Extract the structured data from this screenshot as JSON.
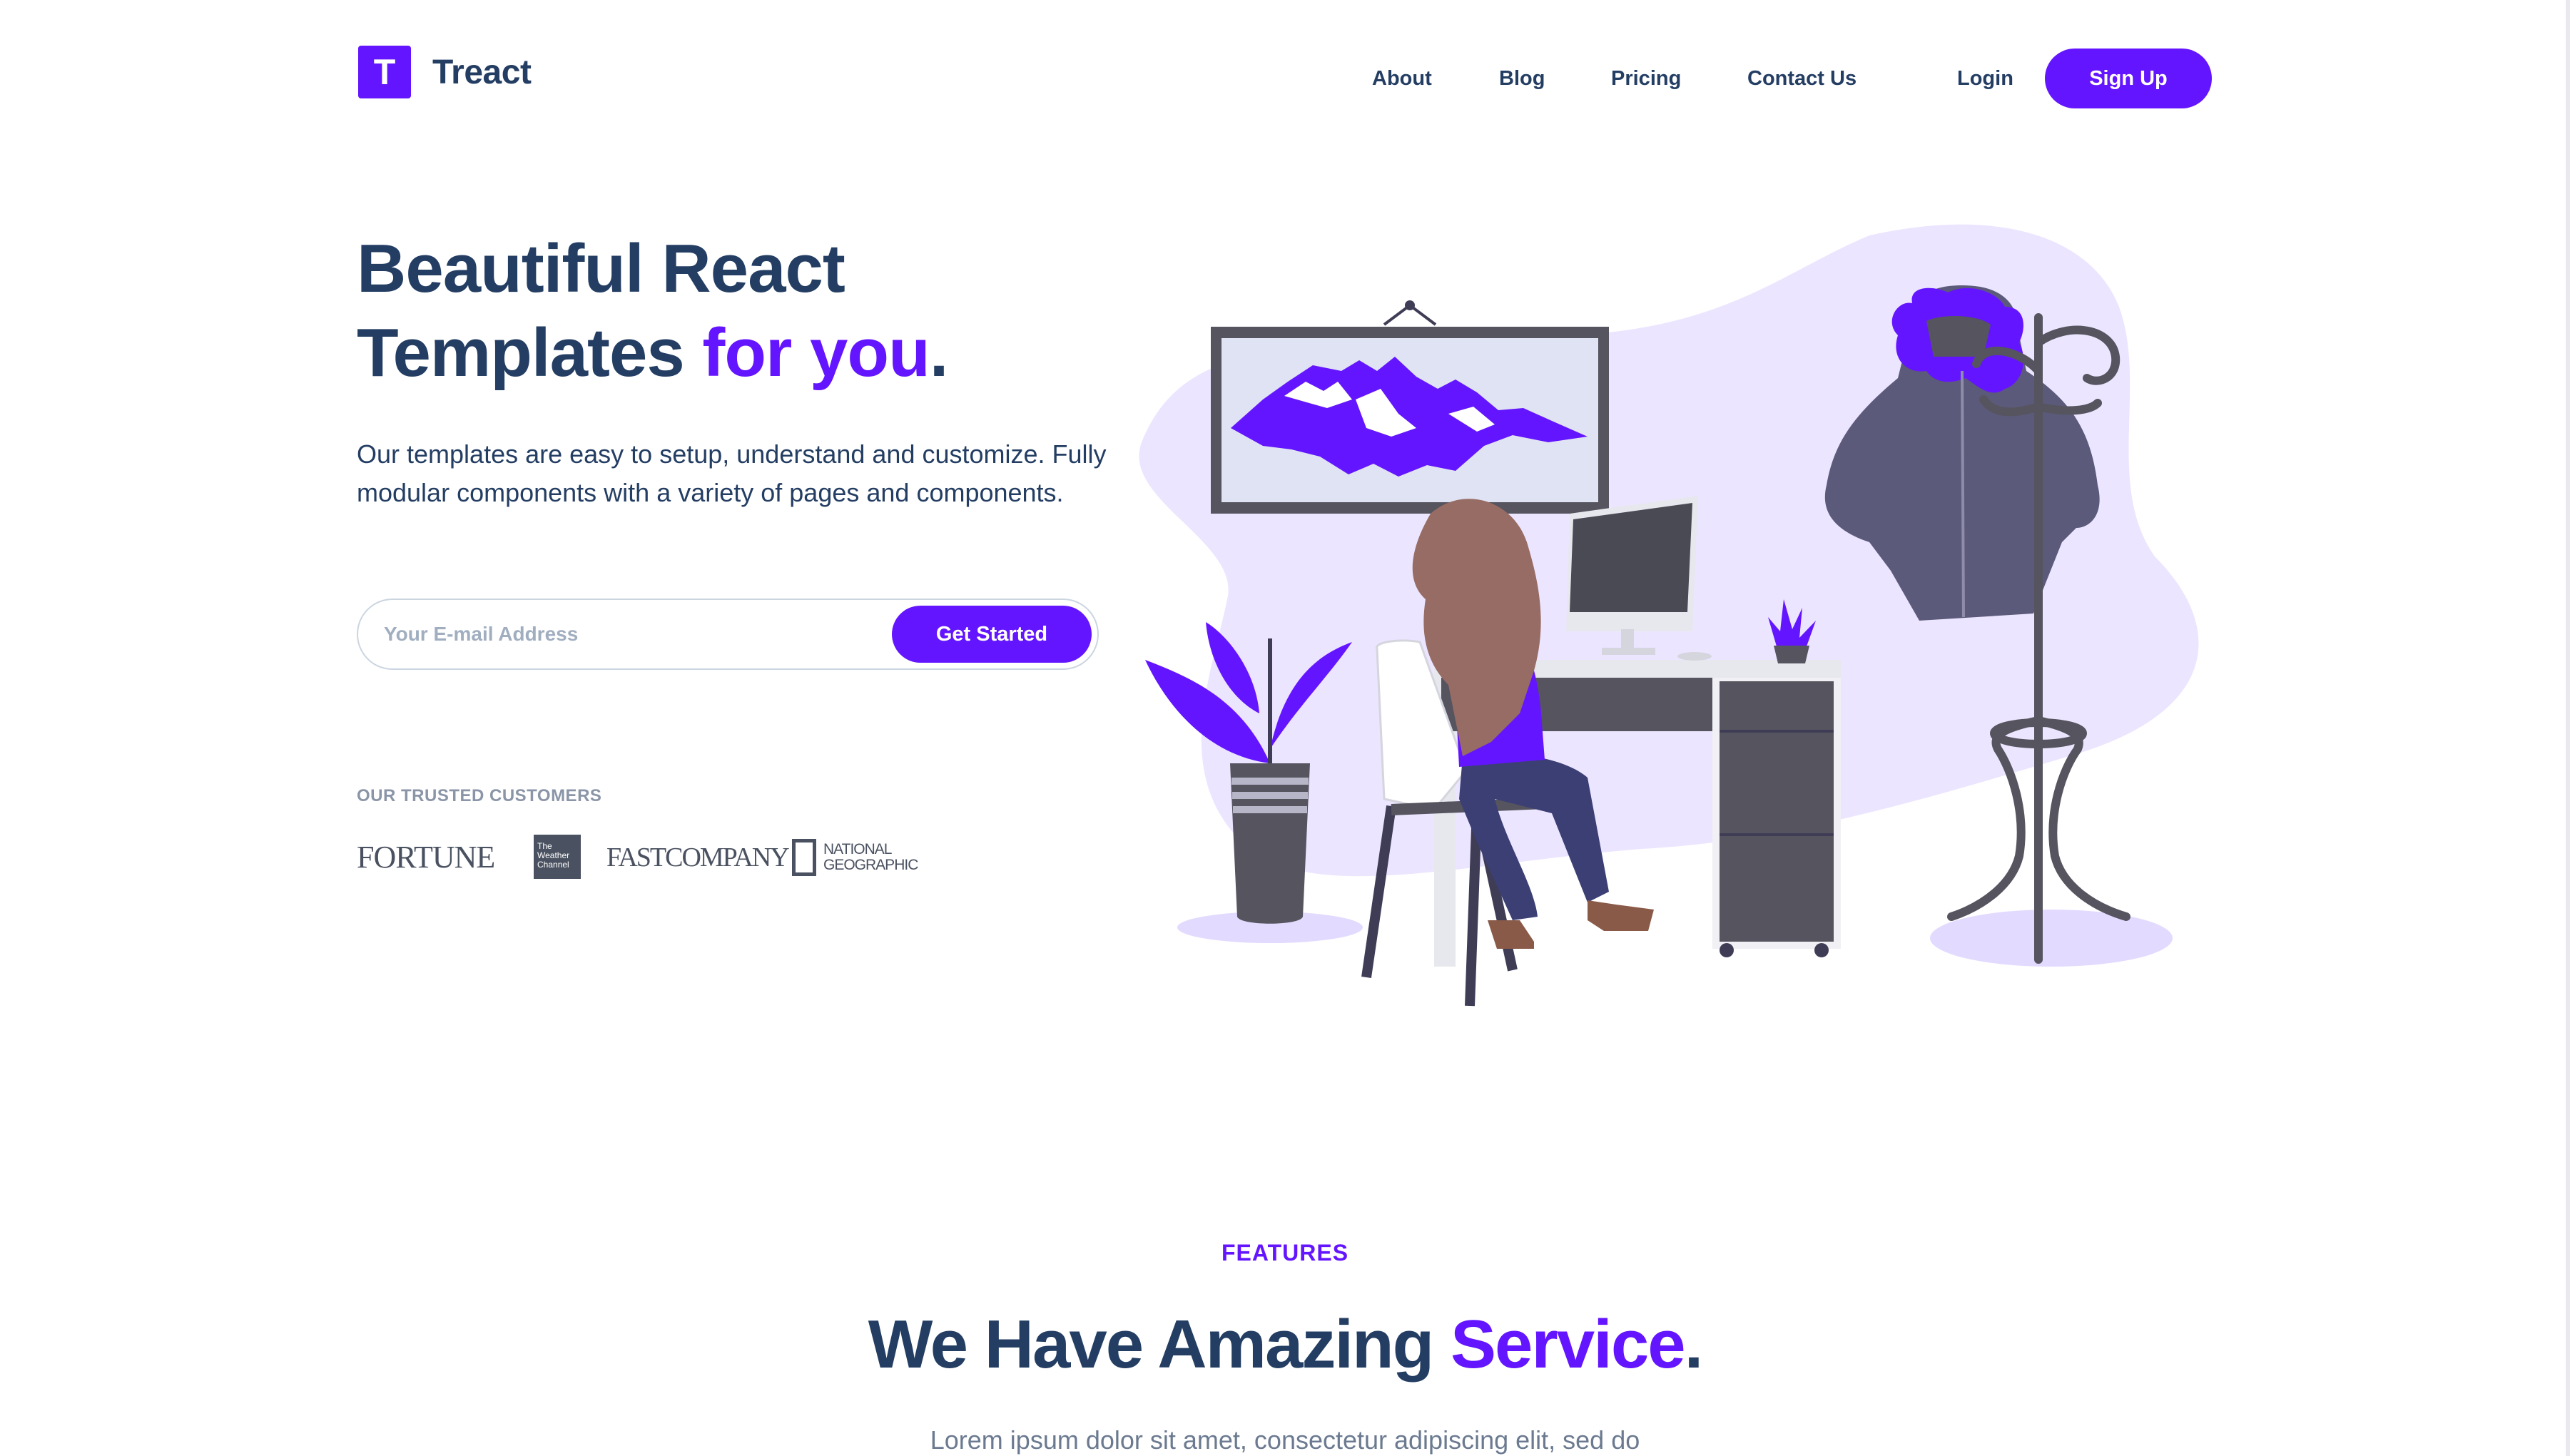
{
  "brand": {
    "logo_letter": "T",
    "name": "Treact",
    "accent_color": "#6415FF",
    "text_color": "#243E63"
  },
  "nav": {
    "links": [
      "About",
      "Blog",
      "Pricing",
      "Contact Us"
    ],
    "login": "Login",
    "signup": "Sign Up"
  },
  "hero": {
    "title_line1": "Beautiful React",
    "title_line2_main": "Templates ",
    "title_line2_accent": "for you",
    "title_period": ".",
    "description": "Our templates are easy to setup, understand and customize. Fully modular components with a variety of pages and components.",
    "email_placeholder": "Your E-mail Address",
    "cta_label": "Get Started"
  },
  "customers": {
    "label": "OUR TRUSTED CUSTOMERS",
    "logos": [
      "FORTUNE",
      "The Weather Channel",
      "FAST COMPANY",
      "NATIONAL GEOGRAPHIC"
    ],
    "fortune": "FORTUNE",
    "weather": [
      "The",
      "Weather",
      "Channel"
    ],
    "fastco": "FASTCOMPANY",
    "natgeo": [
      "NATIONAL",
      "GEOGRAPHIC"
    ]
  },
  "features": {
    "subheading": "FEATURES",
    "title_main": "We Have Amazing ",
    "title_accent": "Service",
    "title_period": ".",
    "description": "Lorem ipsum dolor sit amet, consectetur adipiscing elit, sed do"
  }
}
